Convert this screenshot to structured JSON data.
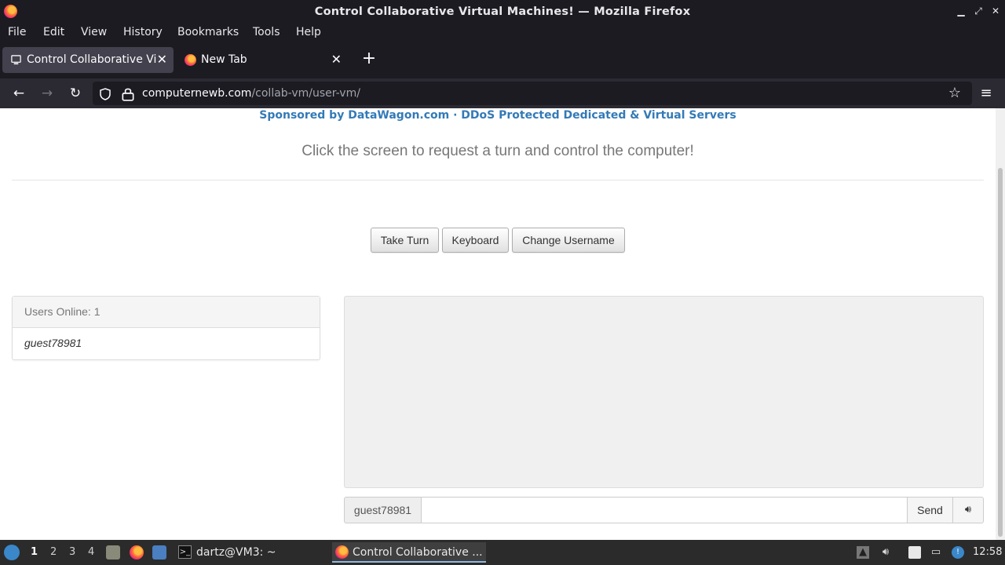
{
  "window": {
    "title": "Control Collaborative Virtual Machines! — Mozilla Firefox"
  },
  "menubar": {
    "items": [
      "File",
      "Edit",
      "View",
      "History",
      "Bookmarks",
      "Tools",
      "Help"
    ]
  },
  "tabs": [
    {
      "label": "Control Collaborative Virtual Machines!",
      "active": true
    },
    {
      "label": "New Tab",
      "active": false
    }
  ],
  "navbar": {
    "url_host": "computernewb.com",
    "url_path": "/collab-vm/user-vm/"
  },
  "page": {
    "sponsor": "Sponsored by DataWagon.com · DDoS Protected Dedicated & Virtual Servers",
    "prompt": "Click the screen to request a turn and control the computer!",
    "buttons": {
      "take_turn": "Take Turn",
      "keyboard": "Keyboard",
      "change_username": "Change Username"
    },
    "users_panel": {
      "heading": "Users Online: 1",
      "users": [
        "guest78981"
      ]
    },
    "chat": {
      "username": "guest78981",
      "input_value": "",
      "send": "Send"
    }
  },
  "taskbar": {
    "workspaces": [
      "1",
      "2",
      "3",
      "4"
    ],
    "tasks": [
      {
        "label": "dartz@VM3: ~"
      },
      {
        "label": "Control Collaborative ..."
      }
    ],
    "clock": "12:58"
  },
  "colors": {
    "link": "#337ab7",
    "chrome_dark": "#1c1b22",
    "toolbar": "#2b2a33"
  }
}
